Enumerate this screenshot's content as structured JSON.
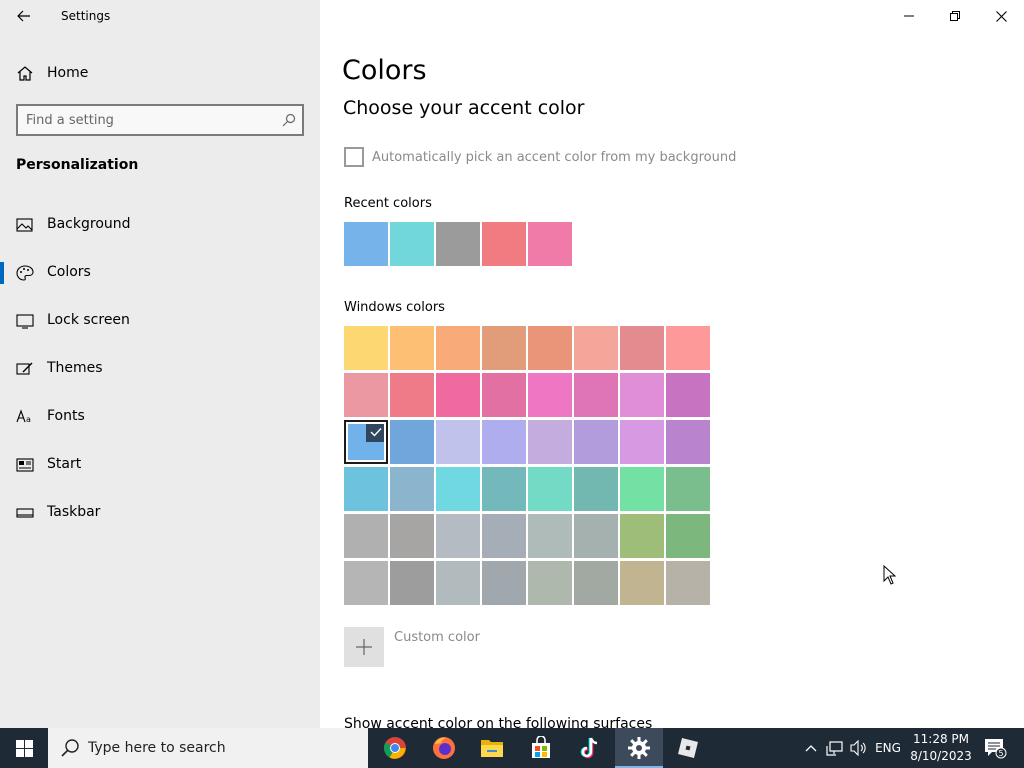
{
  "window": {
    "title": "Settings",
    "controls": {
      "minimize": "minimize",
      "maximize": "restore",
      "close": "close"
    }
  },
  "sidebar": {
    "home_label": "Home",
    "search_placeholder": "Find a setting",
    "section_title": "Personalization",
    "items": [
      {
        "label": "Background",
        "icon": "image-icon"
      },
      {
        "label": "Colors",
        "icon": "palette-icon",
        "selected": true
      },
      {
        "label": "Lock screen",
        "icon": "lock-screen-icon"
      },
      {
        "label": "Themes",
        "icon": "brush-icon"
      },
      {
        "label": "Fonts",
        "icon": "font-icon"
      },
      {
        "label": "Start",
        "icon": "start-icon"
      },
      {
        "label": "Taskbar",
        "icon": "taskbar-icon"
      }
    ]
  },
  "main": {
    "title": "Colors",
    "subtitle": "Choose your accent color",
    "auto_accent_label": "Automatically pick an accent color from my background",
    "auto_accent_checked": false,
    "recent_label": "Recent colors",
    "recent_colors": [
      "#75b3ea",
      "#72d7db",
      "#9b9b9b",
      "#f07b80",
      "#f07aa8"
    ],
    "windows_label": "Windows colors",
    "windows_colors": [
      [
        "#fdd872",
        "#fdbf74",
        "#f8aa78",
        "#e19c7a",
        "#ea9479",
        "#f4a69b",
        "#e48b8f",
        "#fd9a99"
      ],
      [
        "#eb98a3",
        "#f07b88",
        "#f16a9f",
        "#e270a2",
        "#ef76c2",
        "#df74b6",
        "#e08fd6",
        "#c873c2"
      ],
      [
        "#72b2ea",
        "#70a6db",
        "#c1c2ec",
        "#b0adee",
        "#c4acde",
        "#b39cdc",
        "#d899e3",
        "#b983cd"
      ],
      [
        "#6dc3de",
        "#8ab5cc",
        "#6fd8e0",
        "#73b9bb",
        "#73dac6",
        "#72b8b1",
        "#73e0a4",
        "#7bbe8e"
      ],
      [
        "#b0b0b0",
        "#a7a5a3",
        "#b5bbc3",
        "#a5adb6",
        "#aebbb8",
        "#a5b1af",
        "#9ebd79",
        "#7cb77e"
      ],
      [
        "#b5b5b5",
        "#9d9d9d",
        "#b1babd",
        "#a1a8ad",
        "#aeb8ac",
        "#a2a9a3",
        "#c1b491",
        "#b7b2a8"
      ]
    ],
    "selected_color": "#72b2ea",
    "custom_color_label": "Custom color",
    "surfaces_heading": "Show accent color on the following surfaces"
  },
  "taskbar": {
    "search_placeholder": "Type here to search",
    "apps": [
      "chrome-icon",
      "firefox-icon",
      "file-explorer-icon",
      "store-icon",
      "tiktok-icon",
      "settings-icon",
      "roblox-icon"
    ],
    "language": "ENG",
    "time": "11:28 PM",
    "date": "8/10/2023",
    "notification_count": "5"
  },
  "colors": {
    "accent": "#0067c0",
    "sidebar_bg": "#ececec",
    "taskbar_bg": "#1f2a37"
  }
}
